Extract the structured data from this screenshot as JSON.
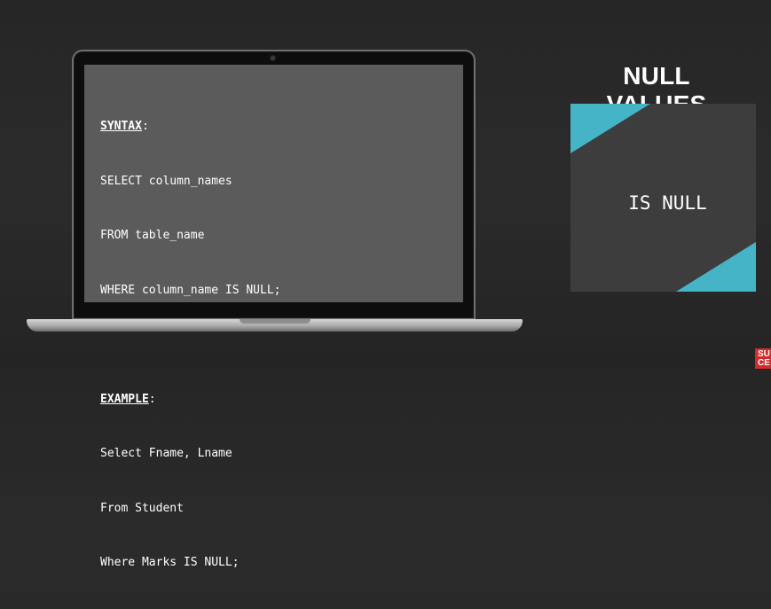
{
  "slide": {
    "title": "NULL VALUES",
    "card_text": "IS NULL"
  },
  "code": {
    "syntax_label": "SYNTAX",
    "syntax_lines": [
      "SELECT column_names",
      "FROM table_name",
      "WHERE column_name IS NULL;"
    ],
    "example_label": "EXAMPLE",
    "example_lines": [
      "Select Fname, Lname",
      "From Student",
      "Where Marks IS NULL;"
    ]
  },
  "logo": {
    "text": "SU CE"
  },
  "colors": {
    "accent": "#44b4c6",
    "background": "#282828",
    "screen": "#5b5b5b",
    "card": "#3d3d3d",
    "logo": "#d32b2b"
  }
}
